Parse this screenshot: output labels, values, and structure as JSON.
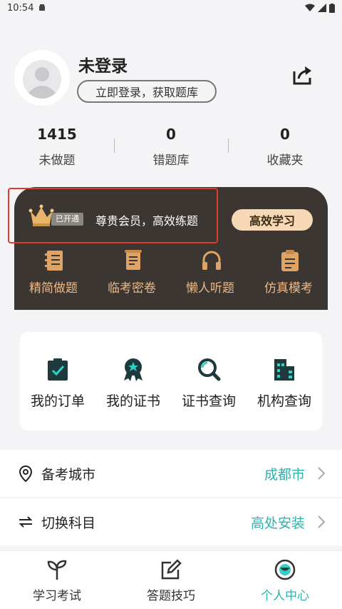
{
  "status_bar": {
    "time": "10:54"
  },
  "profile": {
    "username": "未登录",
    "login_prompt": "立即登录，获取题库"
  },
  "stats": [
    {
      "value": "1415",
      "label": "未做题"
    },
    {
      "value": "0",
      "label": "错题库"
    },
    {
      "value": "0",
      "label": "收藏夹"
    }
  ],
  "vip": {
    "badge": "已开通",
    "text": "尊贵会员，高效练题",
    "cta": "高效学习",
    "features": [
      {
        "icon": "notebook-icon",
        "label": "精简做题"
      },
      {
        "icon": "scroll-exam-icon",
        "label": "临考密卷"
      },
      {
        "icon": "headphones-icon",
        "label": "懒人听题"
      },
      {
        "icon": "clipboard-icon",
        "label": "仿真模考"
      }
    ],
    "highlight_color": "#e03a2f",
    "accent_color": "#e8b98a"
  },
  "services": [
    {
      "icon": "order-check-icon",
      "label": "我的订单"
    },
    {
      "icon": "certificate-medal-icon",
      "label": "我的证书"
    },
    {
      "icon": "magnifier-icon",
      "label": "证书查询"
    },
    {
      "icon": "building-icon",
      "label": "机构查询"
    }
  ],
  "settings": [
    {
      "icon": "location-pin-icon",
      "label": "备考城市",
      "value": "成都市"
    },
    {
      "icon": "swap-icon",
      "label": "切换科目",
      "value": "高处安装"
    }
  ],
  "tabs": [
    {
      "icon": "sprout-icon",
      "label": "学习考试",
      "active": false
    },
    {
      "icon": "edit-square-icon",
      "label": "答题技巧",
      "active": false
    },
    {
      "icon": "profile-circle-icon",
      "label": "个人中心",
      "active": true
    }
  ],
  "colors": {
    "accent": "#2bb3ad",
    "vip_bg": "#3c3633",
    "cta_bg": "#f6d9b4"
  }
}
